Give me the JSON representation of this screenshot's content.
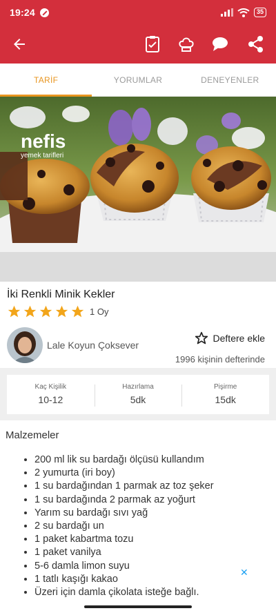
{
  "status_bar": {
    "time": "19:24",
    "battery": "35"
  },
  "tabs": [
    {
      "label": "TARİF"
    },
    {
      "label": "YORUMLAR"
    },
    {
      "label": "DENEYENLER"
    }
  ],
  "hero": {
    "logo_text": "nefis",
    "logo_subtext": "yemek tarifleri"
  },
  "recipe": {
    "title": "İki Renkli Minik Kekler",
    "rating_value": 5,
    "rating_count": "1 Oy"
  },
  "author": {
    "name": "Lale Koyun Çoksever"
  },
  "bookmark": {
    "label": "Deftere ekle",
    "count_text": "1996 kişinin defterinde"
  },
  "info": [
    {
      "label": "Kaç Kişilik",
      "value": "10-12"
    },
    {
      "label": "Hazırlama",
      "value": "5dk"
    },
    {
      "label": "Pişirme",
      "value": "15dk"
    }
  ],
  "ingredients_title": "Malzemeler",
  "ingredients": [
    "200 ml lik su bardağı ölçüsü kullandım",
    "2 yumurta (iri boy)",
    "1 su bardağından 1 parmak az toz şeker",
    "1 su bardağında 2 parmak az yoğurt",
    "Yarım su bardağı sıvı yağ",
    "2 su bardağı un",
    "1 paket kabartma tozu",
    "1 paket vanilya",
    "5-6 damla limon suyu",
    "1 tatlı kaşığı kakao",
    "Üzeri için damla çikolata isteğe bağlı."
  ],
  "colors": {
    "brand_red": "#d32f3c",
    "tab_active": "#e8951f",
    "star": "#f2a51a"
  }
}
